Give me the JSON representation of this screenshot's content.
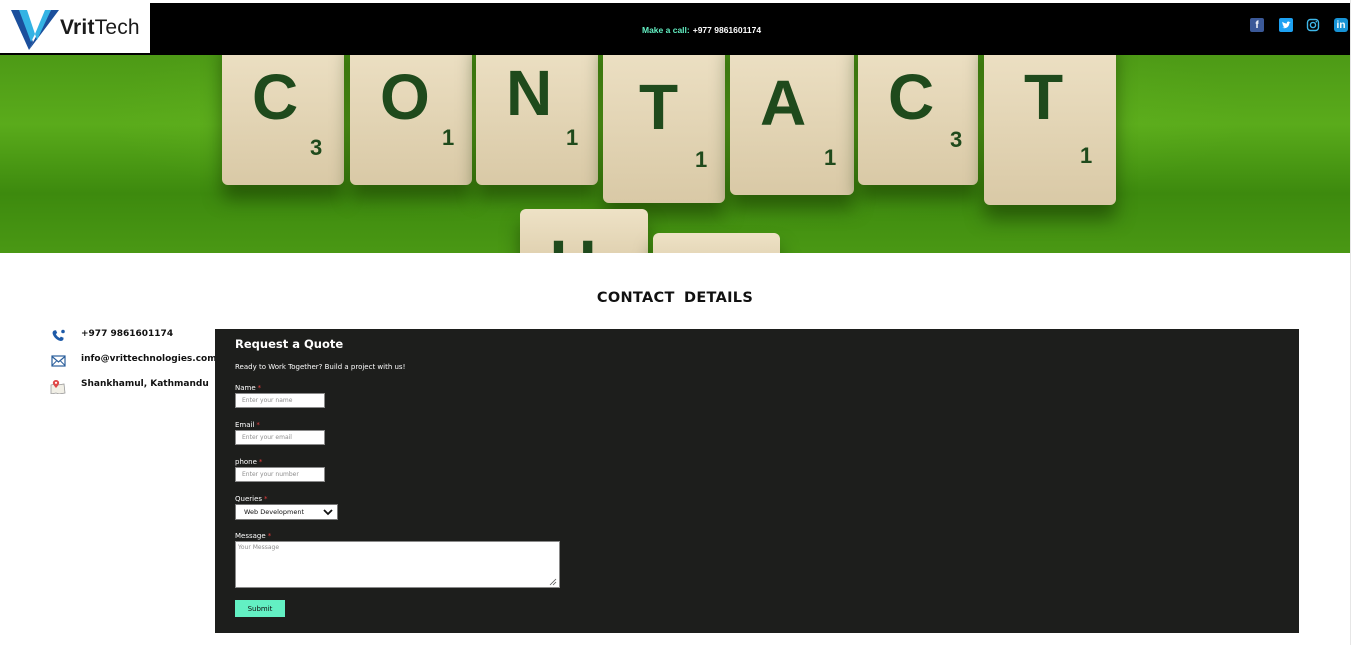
{
  "brand": {
    "name_bold": "Vrit",
    "name_light": "Tech"
  },
  "header": {
    "call_label": "Make a call:",
    "call_number": "+977 9861601174",
    "social": [
      {
        "name": "facebook-icon",
        "glyph": "f"
      },
      {
        "name": "twitter-icon",
        "glyph": "t"
      },
      {
        "name": "instagram-icon",
        "glyph": ""
      },
      {
        "name": "linkedin-icon",
        "glyph": "in"
      }
    ]
  },
  "hero": {
    "tiles": [
      {
        "letter": "C",
        "num": "3"
      },
      {
        "letter": "O",
        "num": "1"
      },
      {
        "letter": "N",
        "num": "1"
      },
      {
        "letter": "T",
        "num": "1"
      },
      {
        "letter": "A",
        "num": "1"
      },
      {
        "letter": "C",
        "num": "3"
      },
      {
        "letter": "T",
        "num": "1"
      },
      {
        "letter": "U",
        "num": ""
      },
      {
        "letter": "",
        "num": ""
      }
    ]
  },
  "section": {
    "title": "CONTACT  DETAILS"
  },
  "contact": {
    "phone": "+977 9861601174",
    "email": "info@vrittechnologies.com",
    "address": "Shankhamul, Kathmandu"
  },
  "form": {
    "title": "Request a Quote",
    "subtitle": "Ready to Work Together? Build a project with us!",
    "required_mark": "*",
    "name_label": "Name",
    "name_placeholder": "Enter your name",
    "email_label": "Email",
    "email_placeholder": "Enter your email",
    "phone_label": "phone",
    "phone_placeholder": "Enter your number",
    "queries_label": "Queries",
    "queries_value": "Web Development",
    "message_label": "Message",
    "message_placeholder": "Your Message",
    "submit_label": "Submit"
  },
  "colors": {
    "accent": "#63f0c3",
    "topbar": "#000000",
    "form_bg": "#1d1e1c",
    "required": "#e23b3b"
  }
}
